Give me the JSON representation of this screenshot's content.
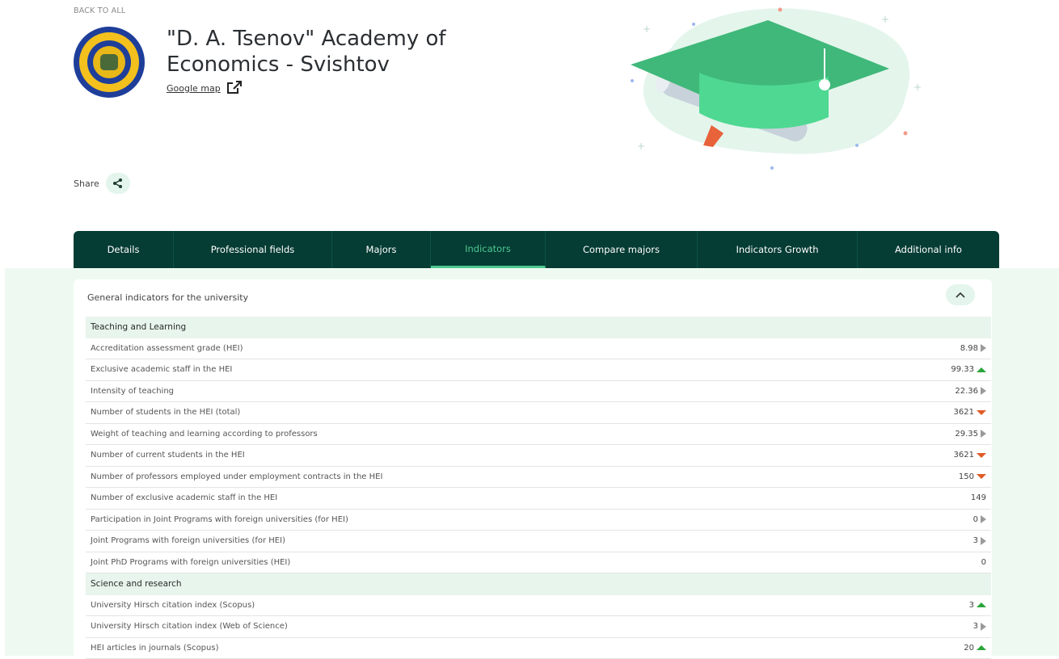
{
  "header": {
    "back_label": "BACK TO ALL",
    "title_line1": "\"D. A. Tsenov\" Academy of",
    "title_line2": "Economics - Svishtov",
    "map_label": "Google map",
    "share_label": "Share"
  },
  "tabs": [
    {
      "label": "Details",
      "active": false
    },
    {
      "label": "Professional fields",
      "active": false
    },
    {
      "label": "Majors",
      "active": false
    },
    {
      "label": "Indicators",
      "active": true
    },
    {
      "label": "Compare majors",
      "active": false
    },
    {
      "label": "Indicators Growth",
      "active": false
    },
    {
      "label": "Additional info",
      "active": false
    }
  ],
  "panel": {
    "heading": "General indicators for the university",
    "rows": [
      {
        "type": "section",
        "label": "Teaching and Learning"
      },
      {
        "type": "row",
        "label": "Accreditation assessment grade (HEI)",
        "value": "8.98",
        "trend": "neutral"
      },
      {
        "type": "row",
        "label": "Exclusive academic staff in the HEI",
        "value": "99.33",
        "trend": "up"
      },
      {
        "type": "row",
        "label": "Intensity of teaching",
        "value": "22.36",
        "trend": "neutral"
      },
      {
        "type": "row",
        "label": "Number of students in the HEI (total)",
        "value": "3621",
        "trend": "down"
      },
      {
        "type": "row",
        "label": "Weight of teaching and learning according to professors",
        "value": "29.35",
        "trend": "neutral"
      },
      {
        "type": "row",
        "label": "Number of current students in the HEI",
        "value": "3621",
        "trend": "down"
      },
      {
        "type": "row",
        "label": "Number of professors employed under employment contracts in the HEI",
        "value": "150",
        "trend": "down"
      },
      {
        "type": "row",
        "label": "Number of exclusive academic staff in the HEI",
        "value": "149",
        "trend": "none"
      },
      {
        "type": "row",
        "label": "Participation in Joint Programs with foreign universities (for HEI)",
        "value": "0",
        "trend": "neutral"
      },
      {
        "type": "row",
        "label": "Joint Programs with foreign universities (for HEI)",
        "value": "3",
        "trend": "neutral"
      },
      {
        "type": "row",
        "label": "Joint PhD Programs with foreign universities (HEI)",
        "value": "0",
        "trend": "none"
      },
      {
        "type": "section",
        "label": "Science and research"
      },
      {
        "type": "row",
        "label": "University Hirsch citation index (Scopus)",
        "value": "3",
        "trend": "up"
      },
      {
        "type": "row",
        "label": "University Hirsch citation index (Web of Science)",
        "value": "3",
        "trend": "neutral"
      },
      {
        "type": "row",
        "label": "HEI articles in journals (Scopus)",
        "value": "20",
        "trend": "up"
      }
    ]
  },
  "colors": {
    "tab_bar": "#053c34",
    "accent": "#4ec88f",
    "trend_up": "#2aa53a",
    "trend_down": "#e05a26",
    "trend_neutral": "#9a9a9a"
  }
}
